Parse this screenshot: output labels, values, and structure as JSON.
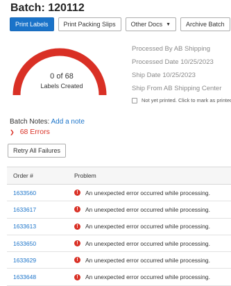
{
  "batch": {
    "title": "Batch: 120112"
  },
  "toolbar": {
    "print_labels": "Print Labels",
    "print_packing_slips": "Print Packing Slips",
    "other_docs": "Other Docs",
    "archive_batch": "Archive Batch"
  },
  "gauge": {
    "count_text": "0 of 68",
    "label": "Labels Created",
    "created": 0,
    "total": 68,
    "color": "#d93025"
  },
  "info": {
    "processed_by": "Processed By AB Shipping",
    "processed_date": "Processed Date 10/25/2023",
    "ship_date": "Ship Date 10/25/2023",
    "ship_from": "Ship From AB Shipping Center",
    "printed_status": "Not yet printed. Click to mark as printed."
  },
  "notes": {
    "label": "Batch Notes:",
    "add_link": "Add a note"
  },
  "errors": {
    "summary": "68 Errors",
    "color": "#d93025"
  },
  "retry": {
    "label": "Retry All Failures"
  },
  "table": {
    "headers": {
      "order": "Order #",
      "problem": "Problem"
    },
    "rows": [
      {
        "order": "1633560",
        "problem": "An unexpected error occurred while processing."
      },
      {
        "order": "1633617",
        "problem": "An unexpected error occurred while processing."
      },
      {
        "order": "1633613",
        "problem": "An unexpected error occurred while processing."
      },
      {
        "order": "1633650",
        "problem": "An unexpected error occurred while processing."
      },
      {
        "order": "1633629",
        "problem": "An unexpected error occurred while processing."
      },
      {
        "order": "1633648",
        "problem": "An unexpected error occurred while processing."
      }
    ]
  }
}
